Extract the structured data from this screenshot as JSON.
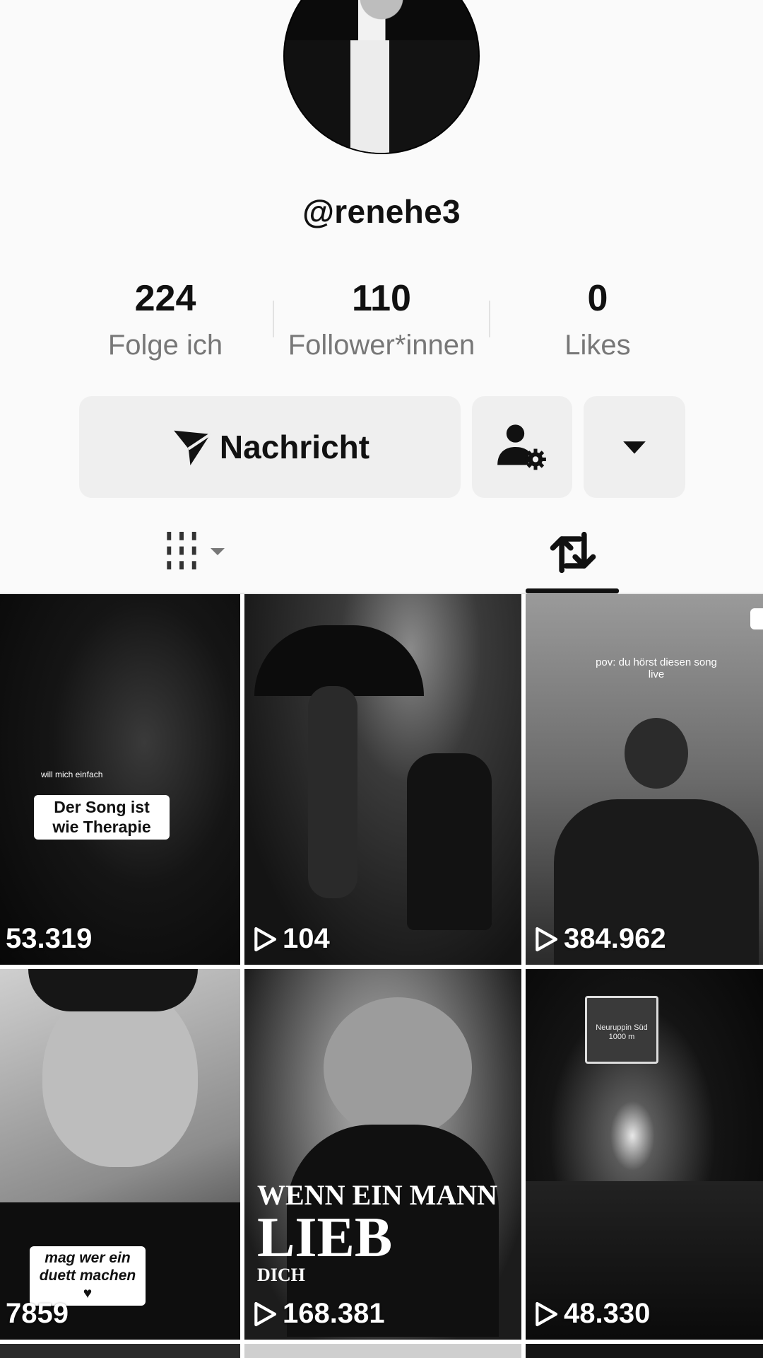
{
  "profile": {
    "username": "@renehe3"
  },
  "stats": [
    {
      "value": "224",
      "label": "Folge ich"
    },
    {
      "value": "110",
      "label": "Follower*innen"
    },
    {
      "value": "0",
      "label": "Likes"
    }
  ],
  "actions": {
    "message_label": "Nachricht"
  },
  "tabs": [
    {
      "name": "videos-grid",
      "icon": "grid-icon",
      "active": false
    },
    {
      "name": "reposts",
      "icon": "repost-icon",
      "active": true
    }
  ],
  "videos": [
    {
      "views": "53.319",
      "play_icon": false,
      "caption_small": "will mich einfach",
      "caption": "Der Song ist wie Therapie"
    },
    {
      "views": "104",
      "play_icon": true
    },
    {
      "views": "384.962",
      "play_icon": true,
      "caption_small": "pov: du hörst diesen song live"
    },
    {
      "views": "7859",
      "play_icon": false,
      "caption": "mag wer ein duett machen ♥"
    },
    {
      "views": "168.381",
      "play_icon": true,
      "caption_line1": "WENN EIN MANN",
      "caption_line2": "LIEB",
      "caption_line3": "DICH"
    },
    {
      "views": "48.330",
      "play_icon": true,
      "sign_text": "Neuruppin Süd 1000 m"
    }
  ]
}
